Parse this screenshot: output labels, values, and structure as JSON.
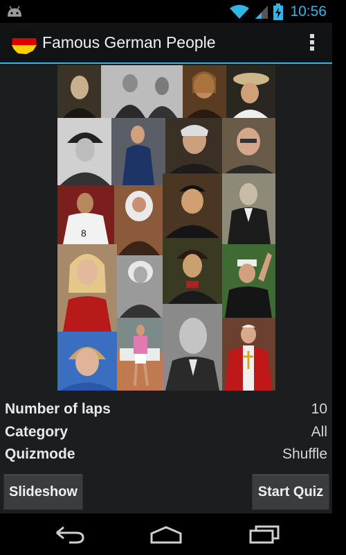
{
  "status_bar": {
    "time": "10:56",
    "icons": [
      "android-debug-icon",
      "wifi-icon",
      "signal-icon",
      "battery-charging-icon"
    ]
  },
  "action_bar": {
    "title": "Famous German People",
    "icons": [
      "german-flag-icon",
      "overflow-menu-icon"
    ]
  },
  "collage": {
    "description_icon": "photo-collage"
  },
  "settings": [
    {
      "label": "Number of laps",
      "value": "10"
    },
    {
      "label": "Category",
      "value": "All"
    },
    {
      "label": "Quizmode",
      "value": "Shuffle"
    }
  ],
  "buttons": {
    "slideshow": "Slideshow",
    "start_quiz": "Start Quiz"
  },
  "nav_bar": {
    "icons": [
      "back-icon",
      "home-icon",
      "recent-apps-icon"
    ]
  },
  "colors": {
    "accent": "#33b5e5",
    "background": "#1b1d1f",
    "button": "#3a3c3e"
  }
}
